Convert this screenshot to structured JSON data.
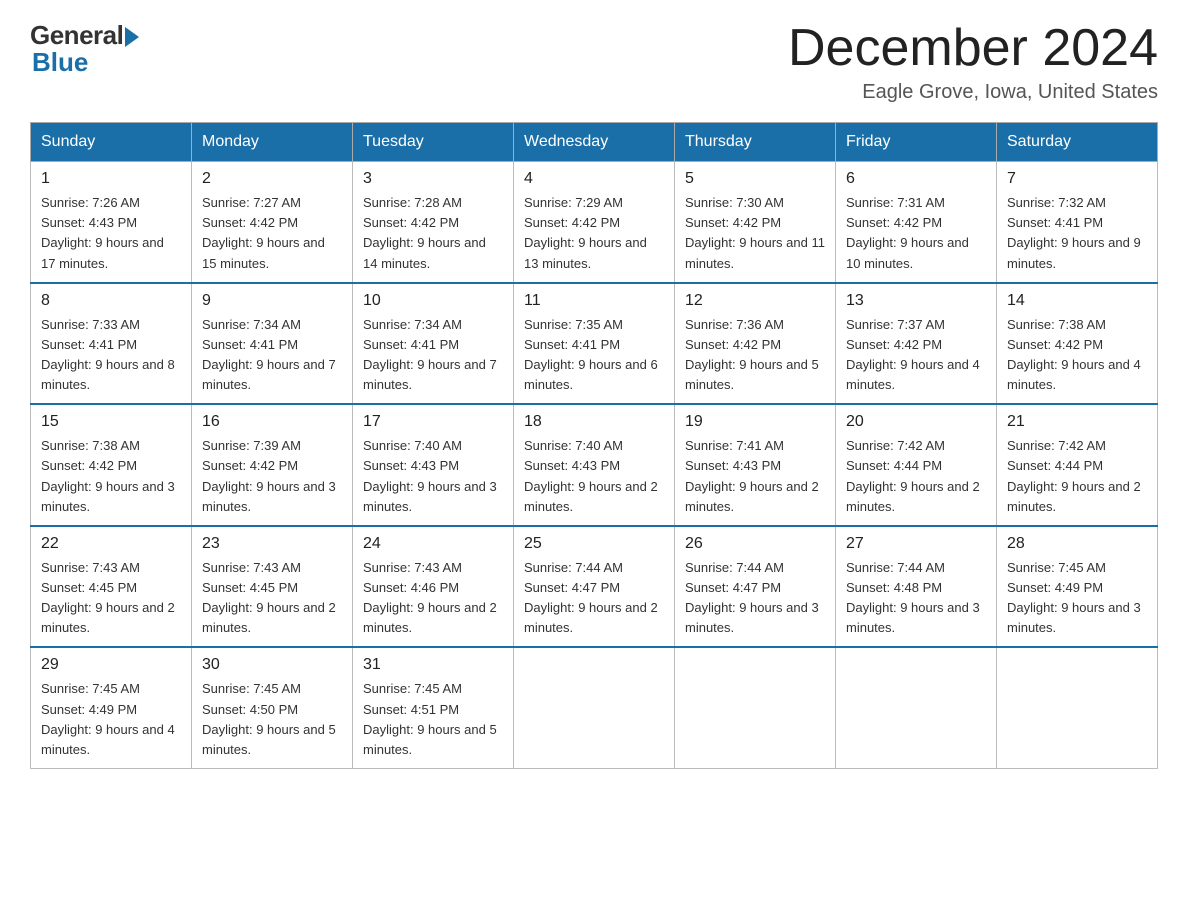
{
  "header": {
    "logo_general": "General",
    "logo_blue": "Blue",
    "month_title": "December 2024",
    "location": "Eagle Grove, Iowa, United States"
  },
  "days_of_week": [
    "Sunday",
    "Monday",
    "Tuesday",
    "Wednesday",
    "Thursday",
    "Friday",
    "Saturday"
  ],
  "weeks": [
    [
      {
        "day": "1",
        "sunrise": "7:26 AM",
        "sunset": "4:43 PM",
        "daylight": "9 hours and 17 minutes."
      },
      {
        "day": "2",
        "sunrise": "7:27 AM",
        "sunset": "4:42 PM",
        "daylight": "9 hours and 15 minutes."
      },
      {
        "day": "3",
        "sunrise": "7:28 AM",
        "sunset": "4:42 PM",
        "daylight": "9 hours and 14 minutes."
      },
      {
        "day": "4",
        "sunrise": "7:29 AM",
        "sunset": "4:42 PM",
        "daylight": "9 hours and 13 minutes."
      },
      {
        "day": "5",
        "sunrise": "7:30 AM",
        "sunset": "4:42 PM",
        "daylight": "9 hours and 11 minutes."
      },
      {
        "day": "6",
        "sunrise": "7:31 AM",
        "sunset": "4:42 PM",
        "daylight": "9 hours and 10 minutes."
      },
      {
        "day": "7",
        "sunrise": "7:32 AM",
        "sunset": "4:41 PM",
        "daylight": "9 hours and 9 minutes."
      }
    ],
    [
      {
        "day": "8",
        "sunrise": "7:33 AM",
        "sunset": "4:41 PM",
        "daylight": "9 hours and 8 minutes."
      },
      {
        "day": "9",
        "sunrise": "7:34 AM",
        "sunset": "4:41 PM",
        "daylight": "9 hours and 7 minutes."
      },
      {
        "day": "10",
        "sunrise": "7:34 AM",
        "sunset": "4:41 PM",
        "daylight": "9 hours and 7 minutes."
      },
      {
        "day": "11",
        "sunrise": "7:35 AM",
        "sunset": "4:41 PM",
        "daylight": "9 hours and 6 minutes."
      },
      {
        "day": "12",
        "sunrise": "7:36 AM",
        "sunset": "4:42 PM",
        "daylight": "9 hours and 5 minutes."
      },
      {
        "day": "13",
        "sunrise": "7:37 AM",
        "sunset": "4:42 PM",
        "daylight": "9 hours and 4 minutes."
      },
      {
        "day": "14",
        "sunrise": "7:38 AM",
        "sunset": "4:42 PM",
        "daylight": "9 hours and 4 minutes."
      }
    ],
    [
      {
        "day": "15",
        "sunrise": "7:38 AM",
        "sunset": "4:42 PM",
        "daylight": "9 hours and 3 minutes."
      },
      {
        "day": "16",
        "sunrise": "7:39 AM",
        "sunset": "4:42 PM",
        "daylight": "9 hours and 3 minutes."
      },
      {
        "day": "17",
        "sunrise": "7:40 AM",
        "sunset": "4:43 PM",
        "daylight": "9 hours and 3 minutes."
      },
      {
        "day": "18",
        "sunrise": "7:40 AM",
        "sunset": "4:43 PM",
        "daylight": "9 hours and 2 minutes."
      },
      {
        "day": "19",
        "sunrise": "7:41 AM",
        "sunset": "4:43 PM",
        "daylight": "9 hours and 2 minutes."
      },
      {
        "day": "20",
        "sunrise": "7:42 AM",
        "sunset": "4:44 PM",
        "daylight": "9 hours and 2 minutes."
      },
      {
        "day": "21",
        "sunrise": "7:42 AM",
        "sunset": "4:44 PM",
        "daylight": "9 hours and 2 minutes."
      }
    ],
    [
      {
        "day": "22",
        "sunrise": "7:43 AM",
        "sunset": "4:45 PM",
        "daylight": "9 hours and 2 minutes."
      },
      {
        "day": "23",
        "sunrise": "7:43 AM",
        "sunset": "4:45 PM",
        "daylight": "9 hours and 2 minutes."
      },
      {
        "day": "24",
        "sunrise": "7:43 AM",
        "sunset": "4:46 PM",
        "daylight": "9 hours and 2 minutes."
      },
      {
        "day": "25",
        "sunrise": "7:44 AM",
        "sunset": "4:47 PM",
        "daylight": "9 hours and 2 minutes."
      },
      {
        "day": "26",
        "sunrise": "7:44 AM",
        "sunset": "4:47 PM",
        "daylight": "9 hours and 3 minutes."
      },
      {
        "day": "27",
        "sunrise": "7:44 AM",
        "sunset": "4:48 PM",
        "daylight": "9 hours and 3 minutes."
      },
      {
        "day": "28",
        "sunrise": "7:45 AM",
        "sunset": "4:49 PM",
        "daylight": "9 hours and 3 minutes."
      }
    ],
    [
      {
        "day": "29",
        "sunrise": "7:45 AM",
        "sunset": "4:49 PM",
        "daylight": "9 hours and 4 minutes."
      },
      {
        "day": "30",
        "sunrise": "7:45 AM",
        "sunset": "4:50 PM",
        "daylight": "9 hours and 5 minutes."
      },
      {
        "day": "31",
        "sunrise": "7:45 AM",
        "sunset": "4:51 PM",
        "daylight": "9 hours and 5 minutes."
      },
      null,
      null,
      null,
      null
    ]
  ]
}
